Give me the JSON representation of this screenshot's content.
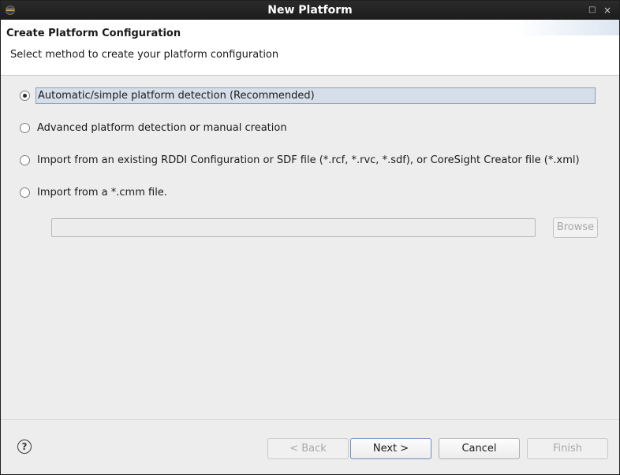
{
  "window": {
    "title": "New Platform",
    "minimize_glyph": "□",
    "close_glyph": "×"
  },
  "header": {
    "title": "Create Platform Configuration",
    "description": "Select method to create your platform configuration"
  },
  "options": [
    {
      "label": "Automatic/simple platform detection (Recommended)",
      "selected": true
    },
    {
      "label": "Advanced platform detection or manual creation",
      "selected": false
    },
    {
      "label": "Import from an existing RDDI Configuration or SDF file (*.rcf, *.rvc, *.sdf), or CoreSight Creator file (*.xml)",
      "selected": false
    },
    {
      "label": "Import from a *.cmm file.",
      "selected": false
    }
  ],
  "cmm_path": {
    "value": "",
    "browse_label": "Browse",
    "enabled": false
  },
  "footer": {
    "help_glyph": "?",
    "back_label": "< Back",
    "next_label": "Next >",
    "cancel_label": "Cancel",
    "finish_label": "Finish"
  }
}
